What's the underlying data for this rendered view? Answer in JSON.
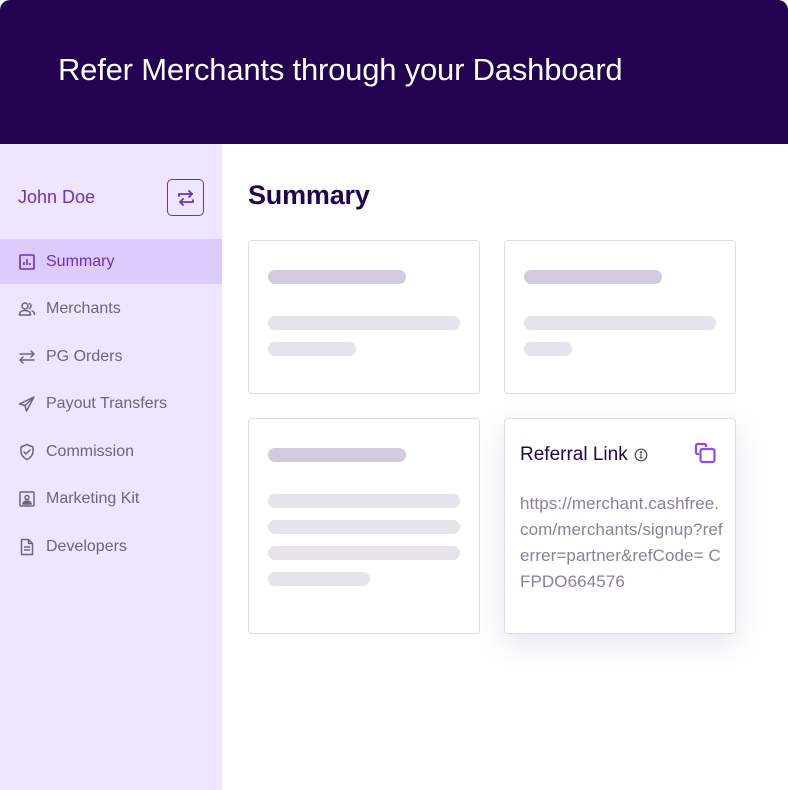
{
  "banner": {
    "title": "Refer Merchants through your Dashboard"
  },
  "sidebar": {
    "user_name": "John Doe",
    "switch_icon": "swap-arrows-icon",
    "items": [
      {
        "label": "Summary",
        "icon": "bar-chart-icon",
        "active": true
      },
      {
        "label": "Merchants",
        "icon": "users-icon",
        "active": false
      },
      {
        "label": "PG Orders",
        "icon": "arrows-exchange-icon",
        "active": false
      },
      {
        "label": "Payout Transfers",
        "icon": "send-icon",
        "active": false
      },
      {
        "label": "Commission",
        "icon": "shield-check-icon",
        "active": false
      },
      {
        "label": "Marketing Kit",
        "icon": "contact-card-icon",
        "active": false
      },
      {
        "label": "Developers",
        "icon": "document-icon",
        "active": false
      }
    ]
  },
  "main": {
    "title": "Summary",
    "referral": {
      "title": "Referral Link",
      "info_icon": "info-icon",
      "copy_icon": "copy-icon",
      "link": "https://​merchant.cashfree.com/merchants/signup?referrer=partner&refCode= CFPDO664576"
    }
  },
  "colors": {
    "banner_bg": "#23024f",
    "sidebar_bg": "#f0e5fe",
    "active_bg": "#decbfd",
    "accent": "#6a31c3",
    "copy_icon": "#8c4ef0"
  }
}
